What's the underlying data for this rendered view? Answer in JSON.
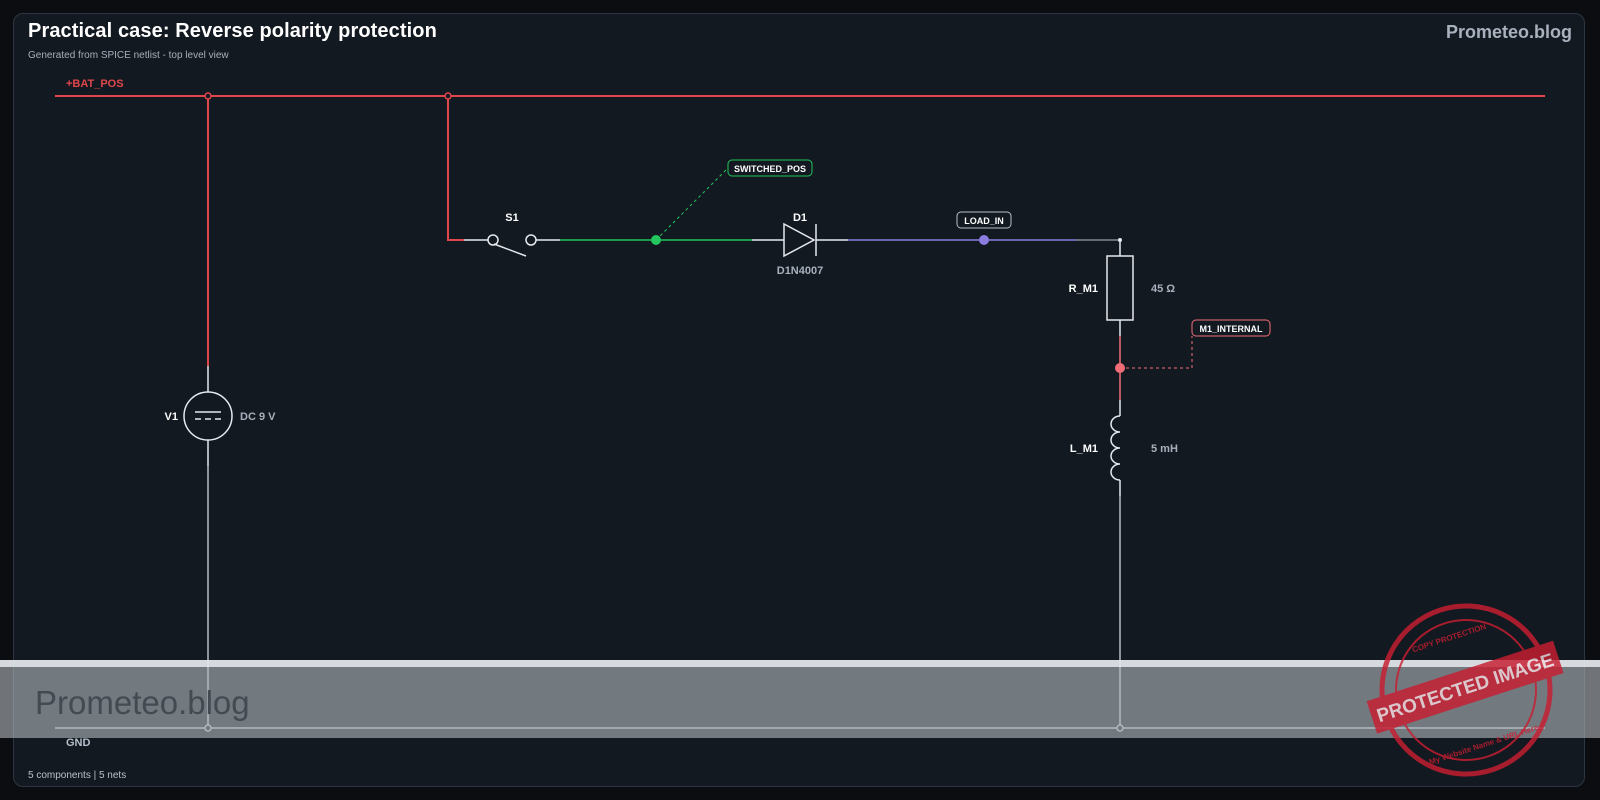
{
  "header": {
    "title": "Practical case: Reverse polarity protection",
    "subtitle": "Generated from SPICE netlist - top level view",
    "brand": "Prometeo.blog"
  },
  "footer": {
    "summary": "5 components | 5 nets"
  },
  "nets": {
    "bat_pos": "+BAT_POS",
    "gnd": "GND",
    "switched_pos": "SWITCHED_POS",
    "load_in": "LOAD_IN",
    "m1_internal": "M1_INTERNAL"
  },
  "components": {
    "v1": {
      "ref": "V1",
      "value": "DC 9 V"
    },
    "s1": {
      "ref": "S1"
    },
    "d1": {
      "ref": "D1",
      "value": "D1N4007"
    },
    "r_m1": {
      "ref": "R_M1",
      "value": "45 Ω"
    },
    "l_m1": {
      "ref": "L_M1",
      "value": "5 mH"
    }
  },
  "watermark": {
    "text": "Prometeo.blog",
    "stamp_main": "PROTECTED IMAGE",
    "stamp_ring": "COPY PROTECTION",
    "stamp_sub": "My Website Name & URL Here"
  },
  "colors": {
    "background": "#0b0d10",
    "panel": "#121920",
    "bat_pos": "#e0474c",
    "switched_pos": "#22c55e",
    "load_in": "#8b7de0",
    "m1_internal": "#f06d78",
    "gnd": "#b6c0cb",
    "component": "#e6e9ee",
    "stamp": "#c81e32"
  }
}
